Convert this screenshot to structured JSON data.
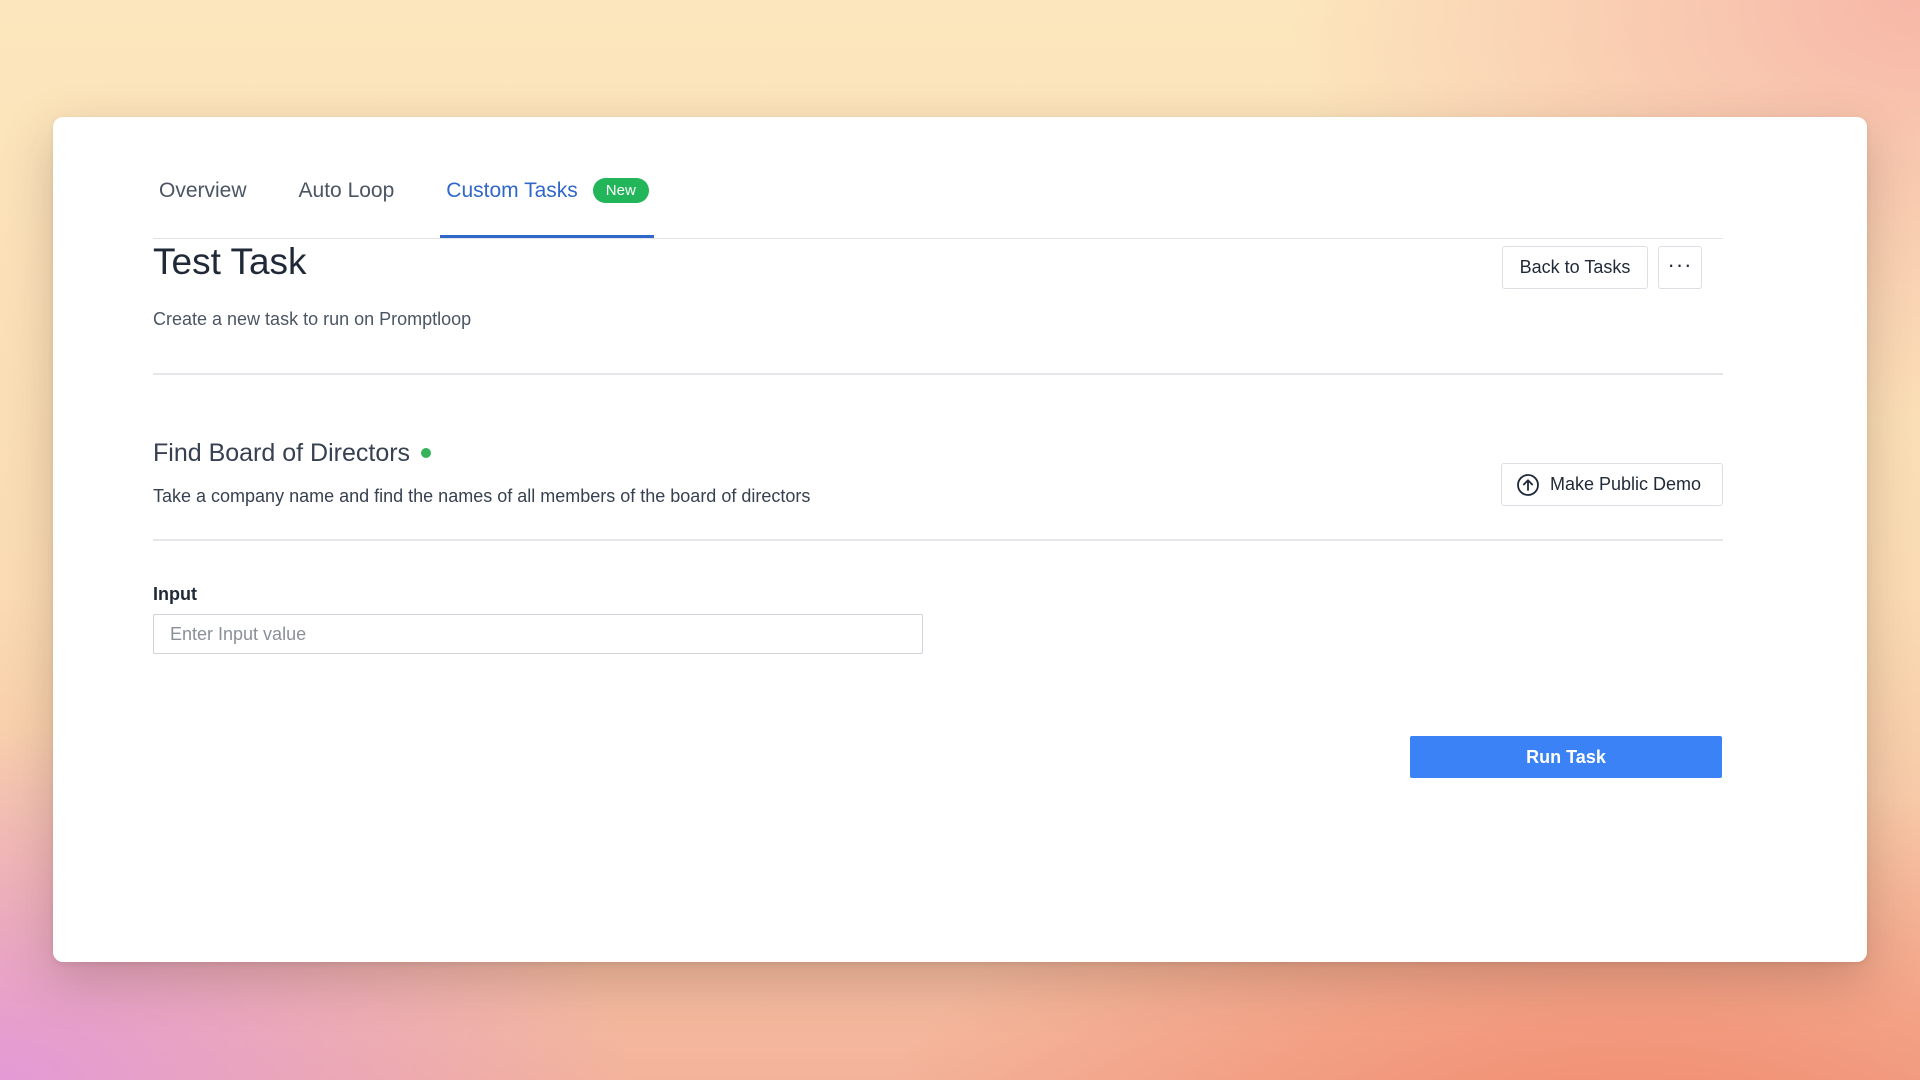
{
  "tabs": [
    {
      "label": "Overview",
      "active": false
    },
    {
      "label": "Auto Loop",
      "active": false
    },
    {
      "label": "Custom Tasks",
      "active": true,
      "badge": "New"
    }
  ],
  "header": {
    "title": "Test Task",
    "subtitle": "Create a new task to run on Promptloop",
    "back_label": "Back to Tasks",
    "more_label": "···"
  },
  "task": {
    "name": "Find Board of Directors",
    "description": "Take a company name and find the names of all members of the board of directors",
    "status_color": "#34b35a",
    "demo_label": "Make Public Demo",
    "demo_icon": "arrow-up-circle-icon"
  },
  "form": {
    "input_label": "Input",
    "input_value": "",
    "input_placeholder": "Enter Input value",
    "run_label": "Run Task"
  },
  "colors": {
    "accent": "#2f68c9",
    "primary_button": "#3b82f6",
    "badge": "#22b55a"
  }
}
